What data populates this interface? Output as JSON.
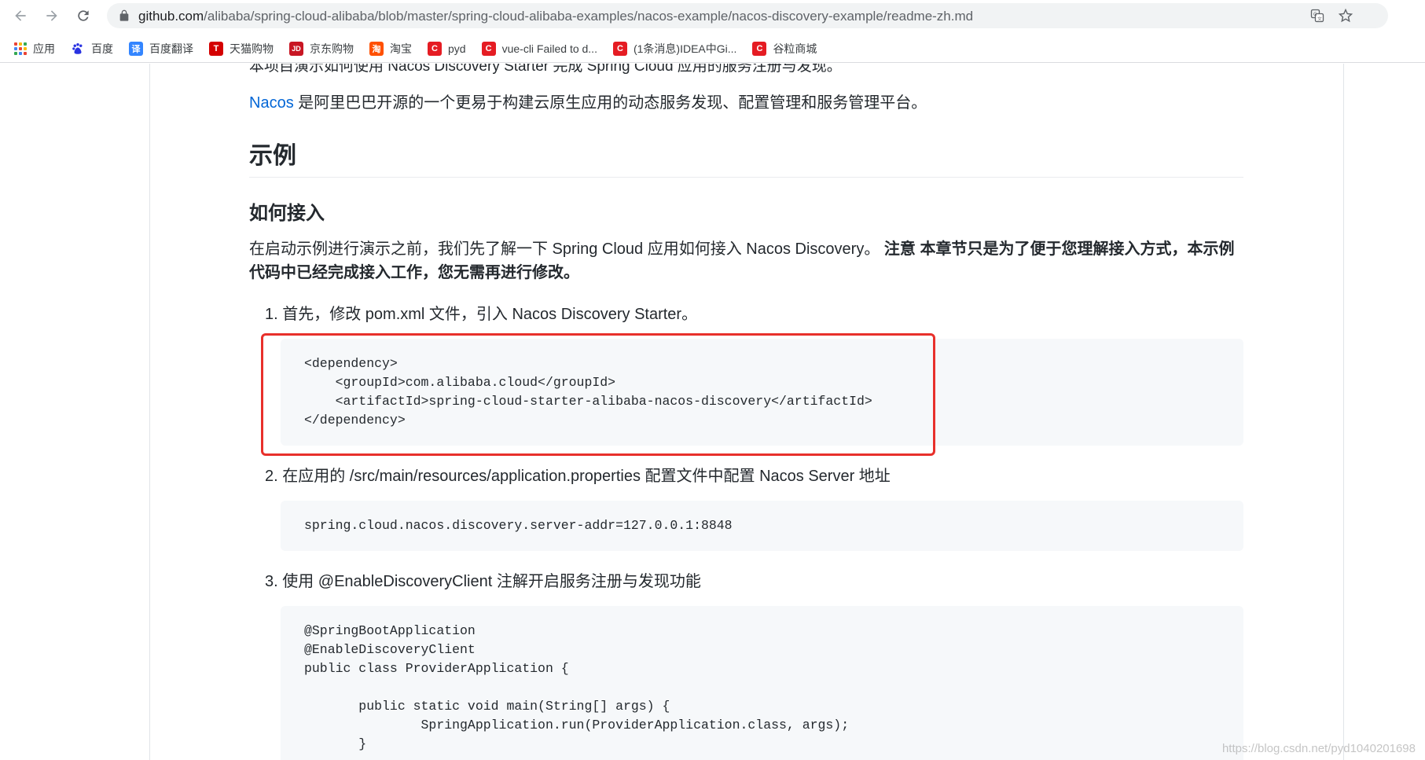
{
  "browser": {
    "url_host": "github.com",
    "url_path": "/alibaba/spring-cloud-alibaba/blob/master/spring-cloud-alibaba-examples/nacos-example/nacos-discovery-example/readme-zh.md"
  },
  "bookmarks": {
    "apps": "应用",
    "items": [
      {
        "label": "百度",
        "icon": "baidu-icon",
        "glyph": "",
        "color": "#2932e1"
      },
      {
        "label": "百度翻译",
        "icon": "translate-icon",
        "glyph": "译",
        "color": "#3385ff"
      },
      {
        "label": "天猫购物",
        "icon": "tmall-icon",
        "glyph": "T",
        "color": "#d40000"
      },
      {
        "label": "京东购物",
        "icon": "jd-icon",
        "glyph": "JD",
        "color": "#c81623"
      },
      {
        "label": "淘宝",
        "icon": "taobao-icon",
        "glyph": "淘",
        "color": "#ff5000"
      },
      {
        "label": "pyd",
        "icon": "csdn-icon",
        "glyph": "C",
        "color": "#e51c23"
      },
      {
        "label": "vue-cli Failed to d...",
        "icon": "csdn-icon",
        "glyph": "C",
        "color": "#e51c23"
      },
      {
        "label": "(1条消息)IDEA中Gi...",
        "icon": "csdn-icon",
        "glyph": "C",
        "color": "#e51c23"
      },
      {
        "label": "谷粒商城",
        "icon": "csdn-icon",
        "glyph": "C",
        "color": "#e51c23"
      }
    ]
  },
  "article": {
    "cutoff_line": "本项目演示如何使用 Nacos Discovery Starter 完成 Spring Cloud 应用的服务注册与发现。",
    "intro_link": "Nacos",
    "intro_rest": " 是阿里巴巴开源的一个更易于构建云原生应用的动态服务发现、配置管理和服务管理平台。",
    "h2": "示例",
    "h3": "如何接入",
    "para_plain": "在启动示例进行演示之前，我们先了解一下 Spring Cloud 应用如何接入 Nacos Discovery。 ",
    "para_bold": "注意 本章节只是为了便于您理解接入方式，本示例代码中已经完成接入工作，您无需再进行修改。",
    "step1": "1. 首先，修改 pom.xml 文件，引入 Nacos Discovery Starter。",
    "code1": "<dependency>\n    <groupId>com.alibaba.cloud</groupId>\n    <artifactId>spring-cloud-starter-alibaba-nacos-discovery</artifactId>\n</dependency>",
    "step2": "2. 在应用的 /src/main/resources/application.properties 配置文件中配置 Nacos Server 地址",
    "code2": "spring.cloud.nacos.discovery.server-addr=127.0.0.1:8848",
    "step3": "3. 使用 @EnableDiscoveryClient 注解开启服务注册与发现功能",
    "code3": "@SpringBootApplication\n@EnableDiscoveryClient\npublic class ProviderApplication {\n\n       public static void main(String[] args) {\n               SpringApplication.run(ProviderApplication.class, args);\n       }"
  },
  "watermark": "https://blog.csdn.net/pyd1040201698",
  "colors": {
    "link": "#0366d6",
    "highlight": "#e8302b",
    "code_bg": "#f6f8fa"
  }
}
